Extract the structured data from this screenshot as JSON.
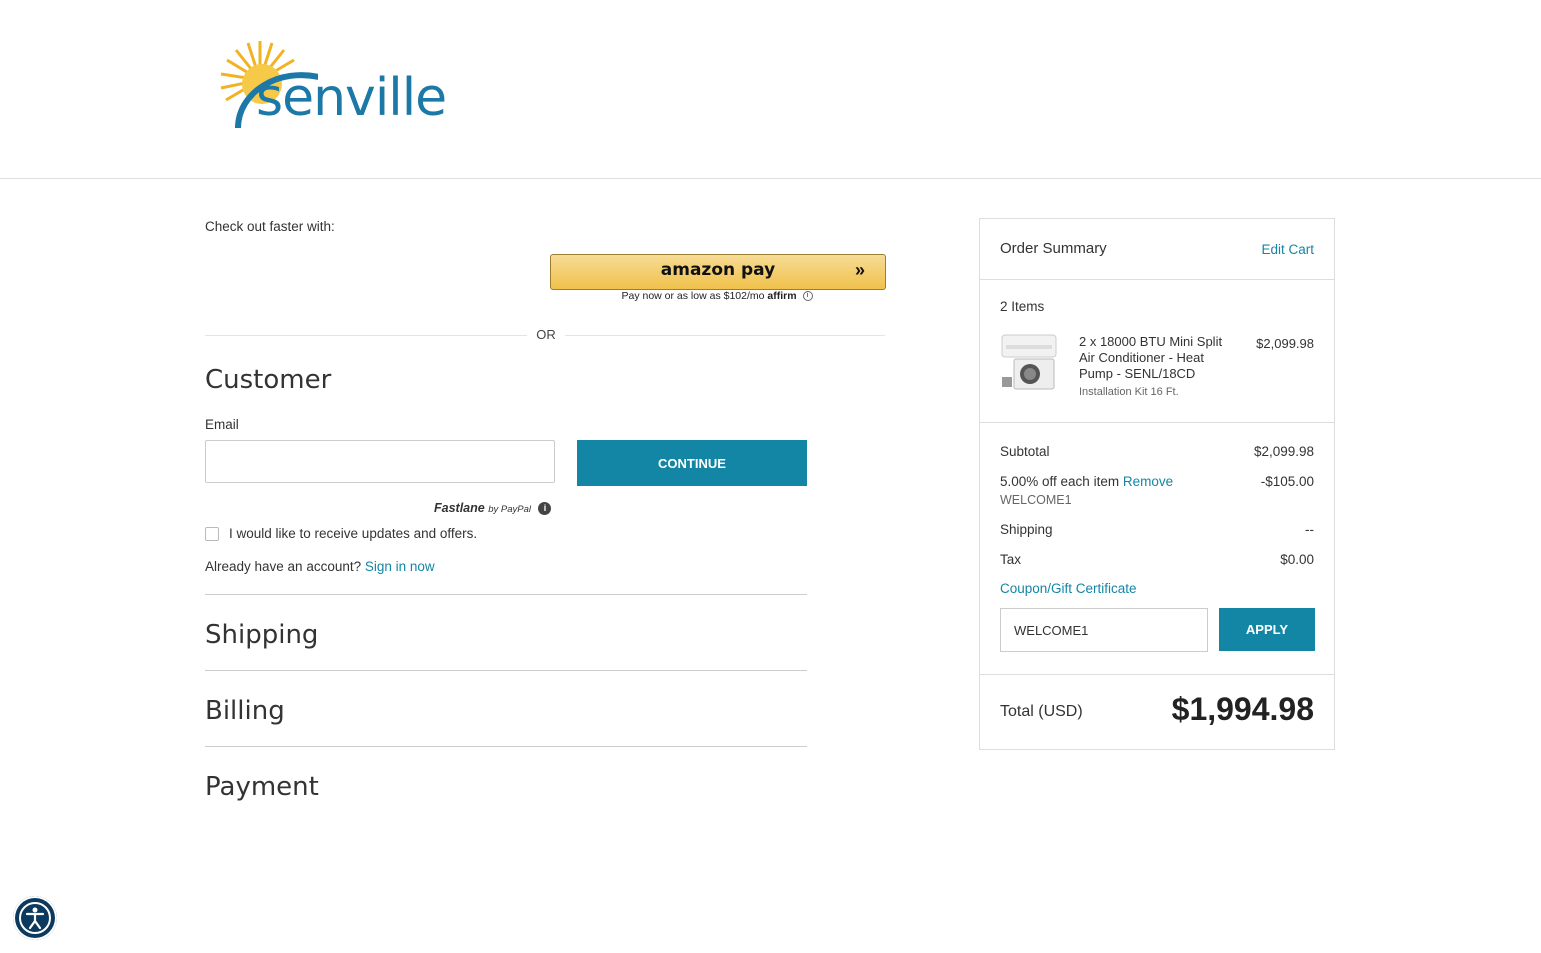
{
  "brand": {
    "logo_text": "senville",
    "accent_color": "#1486a5"
  },
  "express": {
    "heading": "Check out faster with:",
    "amazon_pay_label": "amazon pay",
    "affirm_text": "Pay now or as low as $102/mo",
    "affirm_brand": "affirm",
    "or_text": "OR"
  },
  "customer": {
    "title": "Customer",
    "email_label": "Email",
    "email_value": "",
    "continue_label": "CONTINUE",
    "fastlane_label": "Fastlane",
    "fastlane_by": "by PayPal",
    "updates_label": "I would like to receive updates and offers.",
    "account_prompt": "Already have an account?",
    "sign_in_label": "Sign in now"
  },
  "steps": {
    "shipping": "Shipping",
    "billing": "Billing",
    "payment": "Payment"
  },
  "summary": {
    "title": "Order Summary",
    "edit_cart": "Edit Cart",
    "item_count": "2 Items",
    "item": {
      "name": "2 x 18000 BTU Mini Split Air Conditioner - Heat Pump - SENL/18CD",
      "option": "Installation Kit 16 Ft.",
      "price": "$2,099.98"
    },
    "subtotal_label": "Subtotal",
    "subtotal_value": "$2,099.98",
    "discount_label": "5.00% off each item",
    "discount_remove": "Remove",
    "discount_code": "WELCOME1",
    "discount_value": "-$105.00",
    "shipping_label": "Shipping",
    "shipping_value": "--",
    "tax_label": "Tax",
    "tax_value": "$0.00",
    "coupon_label": "Coupon/Gift Certificate",
    "coupon_value": "WELCOME1",
    "apply_label": "APPLY",
    "total_label": "Total (USD)",
    "total_value": "$1,994.98"
  }
}
